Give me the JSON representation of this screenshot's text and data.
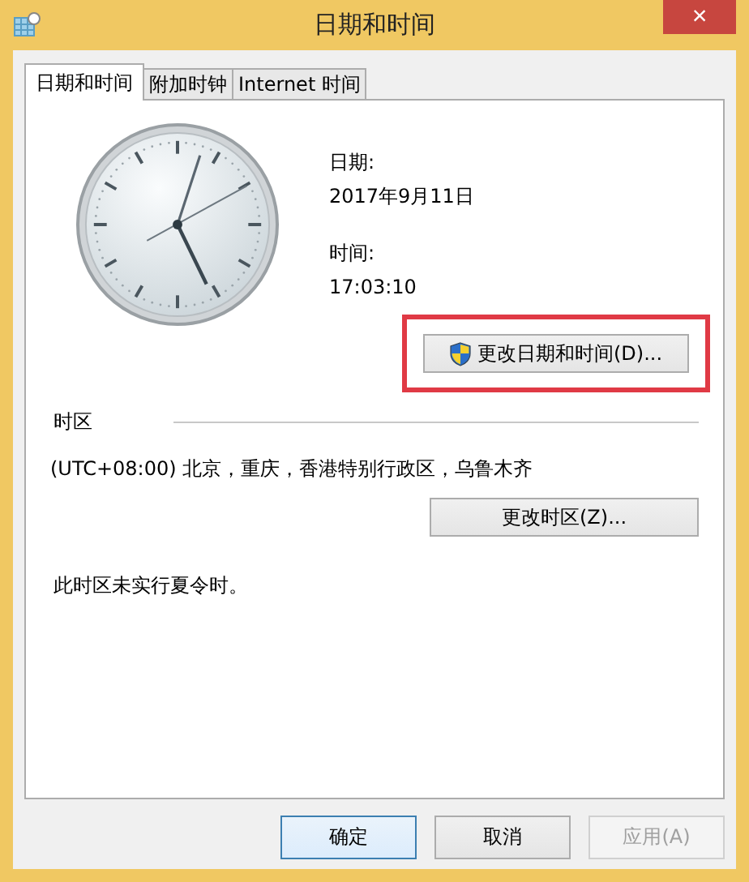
{
  "window": {
    "title": "日期和时间",
    "close": "×"
  },
  "tabs": [
    {
      "label": "日期和时间",
      "selected": true
    },
    {
      "label": "附加时钟",
      "selected": false
    },
    {
      "label": "Internet 时间",
      "selected": false
    }
  ],
  "date_time": {
    "date_label": "日期:",
    "date": "2017年9月11日",
    "time_label": "时间:",
    "time": "17:03:10",
    "change_button": {
      "label": "更改日期和时间(D)...",
      "highlighted": true
    }
  },
  "time_zone": {
    "heading": "时区",
    "zone": "(UTC+08:00) 北京，重庆，香港特别行政区，乌鲁木齐",
    "change_button": {
      "label": "更改时区(Z)..."
    },
    "note": "此时区未实行夏令时。"
  },
  "buttons": [
    {
      "label": "确定",
      "default": true,
      "disabled": false
    },
    {
      "label": "取消",
      "default": false,
      "disabled": false
    },
    {
      "label": "应用(A)",
      "default": false,
      "disabled": true
    }
  ]
}
